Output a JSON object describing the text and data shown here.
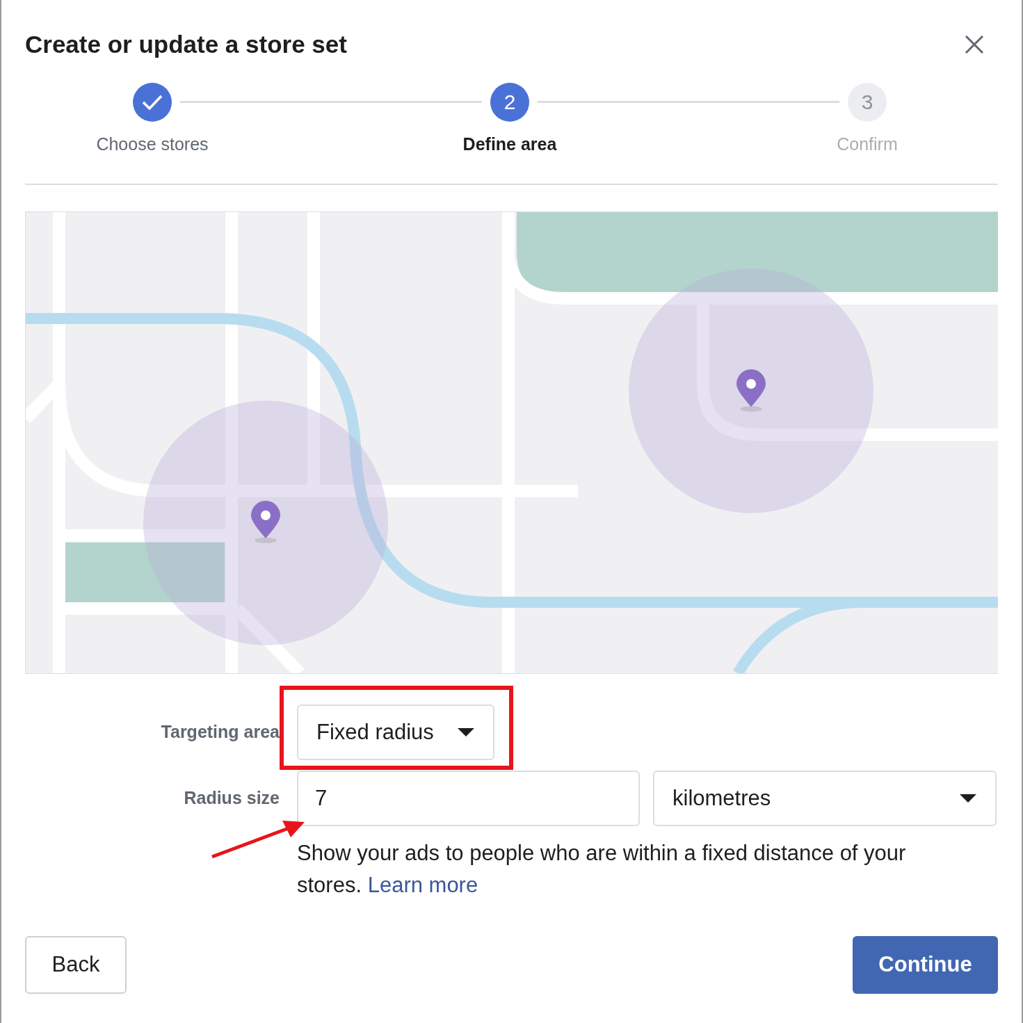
{
  "dialog": {
    "title": "Create or update a store set"
  },
  "steps": [
    {
      "label": "Choose stores",
      "kind": "complete"
    },
    {
      "label": "Define area",
      "number": "2",
      "kind": "current"
    },
    {
      "label": "Confirm",
      "number": "3",
      "kind": "upcoming"
    }
  ],
  "form": {
    "targeting_area": {
      "label": "Targeting area",
      "value": "Fixed radius"
    },
    "radius_size": {
      "label": "Radius size",
      "value": "7"
    },
    "unit": {
      "value": "kilometres"
    },
    "help": {
      "text": "Show your ads to people who are within a fixed distance of your stores.",
      "link": "Learn more"
    }
  },
  "annotations": {
    "highlight_frame": true,
    "arrow": true
  },
  "buttons": {
    "back": "Back",
    "continue": "Continue"
  }
}
